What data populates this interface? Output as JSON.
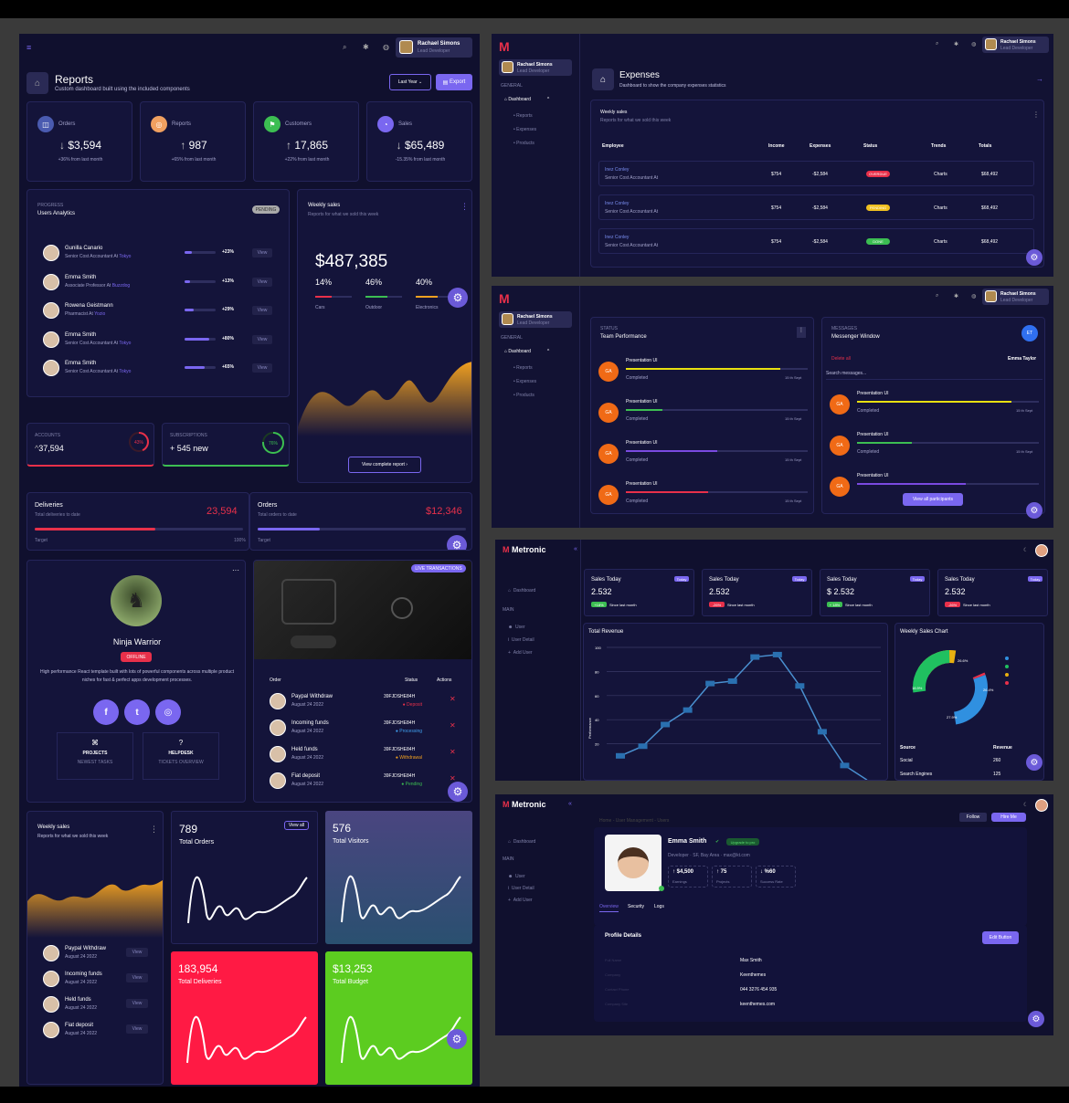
{
  "left": {
    "header": {
      "user_name": "Rachael Simons",
      "user_role": "Lead Developer"
    },
    "page": {
      "title": "Reports",
      "subtitle": "Custom dashboard built using the included components",
      "filter": "Last Year",
      "export": "Export"
    },
    "stats": [
      {
        "label": "Orders",
        "value": "$3,594",
        "dir": "↓",
        "note": "+36% from last month",
        "color": "#4a5bb0",
        "icon": "◫"
      },
      {
        "label": "Reports",
        "value": "987",
        "dir": "↑",
        "note": "+65% from last month",
        "color": "#f0a060",
        "icon": "◎"
      },
      {
        "label": "Customers",
        "value": "17,865",
        "dir": "↑",
        "note": "+22% from last month",
        "color": "#3cbe52",
        "icon": "⚑"
      },
      {
        "label": "Sales",
        "value": "$65,489",
        "dir": "↓",
        "note": "-15.35% from last month",
        "color": "#7a67f0",
        "icon": "◔"
      }
    ],
    "analytics": {
      "kicker": "PROGRESS",
      "title": "Users Analytics",
      "badge": "PENDING",
      "view": "View",
      "rows": [
        {
          "name": "Gunilla Canario",
          "role": "Senior Cost Accountant At",
          "org": "Tokyo",
          "pct": "+23%",
          "fill": 0.23
        },
        {
          "name": "Emma Smith",
          "role": "Associate Professor At",
          "org": "Buzzdog",
          "pct": "+13%",
          "fill": 0.13
        },
        {
          "name": "Rowena Geistmann",
          "role": "Pharmacist At",
          "org": "Yozio",
          "pct": "+29%",
          "fill": 0.29
        },
        {
          "name": "Emma Smith",
          "role": "Senior Cost Accountant At",
          "org": "Tokyo",
          "pct": "+80%",
          "fill": 0.8
        },
        {
          "name": "Emma Smith",
          "role": "Senior Cost Accountant At",
          "org": "Tokyo",
          "pct": "+65%",
          "fill": 0.65
        }
      ]
    },
    "weekly": {
      "title": "Weekly sales",
      "subtitle": "Reports for what we sold this week",
      "amount": "$487,385",
      "splits": [
        {
          "pct": "14%",
          "label": "Cars",
          "color": "#e8304a"
        },
        {
          "pct": "46%",
          "label": "Outdoor",
          "color": "#3cbe52"
        },
        {
          "pct": "40%",
          "label": "Electronics",
          "color": "#f0a020"
        }
      ],
      "button": "View complete report ›"
    },
    "accounts": {
      "label": "ACCOUNTS",
      "value": "37,594",
      "pct": "43%",
      "fill": 0.43
    },
    "subs": {
      "label": "SUBSCRIPTIONS",
      "value": "+ 545 new",
      "pct": "76%",
      "fill": 0.76
    },
    "deliveries": {
      "title": "Deliveries",
      "subtitle": "Total deliveries to date",
      "value": "23,594",
      "target": "Target",
      "target_pct": "100%",
      "fill": 0.58
    },
    "orders": {
      "title": "Orders",
      "subtitle": "Total orders to date",
      "value": "$12,346",
      "target": "Target",
      "fill": 0.3
    },
    "profile": {
      "name": "Ninja Warrior",
      "status": "OFFLINE",
      "bio": "High performance React template built with lots of powerful components across multiple product niches for fast & perfect apps development processes.",
      "tiles": [
        {
          "title": "PROJECTS",
          "sub": "NEWEST TASKS"
        },
        {
          "title": "HELPDESK",
          "sub": "TICKETS OVERVIEW"
        }
      ]
    },
    "transactions": {
      "badge": "LIVE TRANSACTIONS",
      "col_order": "Order",
      "col_status": "Status",
      "col_actions": "Actions",
      "rows": [
        {
          "title": "Paypal Withdraw",
          "date": "August 24 2022",
          "id": "39FJDSHE84H",
          "status": "Deposit",
          "color": "#e8304a"
        },
        {
          "title": "Incoming funds",
          "date": "August 24 2022",
          "id": "39FJDSHE84H",
          "status": "Processing",
          "color": "#40a0f0"
        },
        {
          "title": "Held funds",
          "date": "August 24 2022",
          "id": "39FJDSHE84H",
          "status": "Withdrawal",
          "color": "#f0a020"
        },
        {
          "title": "Fiat deposit",
          "date": "August 24 2022",
          "id": "39FJDSHE84H",
          "status": "Pending",
          "color": "#3cbe52"
        }
      ]
    },
    "weekly2": {
      "title": "Weekly sales",
      "subtitle": "Reports for what we sold this week",
      "view": "View",
      "rows": [
        {
          "title": "Paypal Withdraw",
          "date": "August 24 2022"
        },
        {
          "title": "Incoming funds",
          "date": "August 24 2022"
        },
        {
          "title": "Held funds",
          "date": "August 24 2022"
        },
        {
          "title": "Fiat deposit",
          "date": "August 24 2022"
        }
      ]
    },
    "tiles": [
      {
        "value": "789",
        "label": "Total Orders",
        "link": "View all"
      },
      {
        "value": "576",
        "label": "Total Visitors"
      },
      {
        "value": "183,954",
        "label": "Total Deliveries"
      },
      {
        "value": "$13,253",
        "label": "Total Budget"
      }
    ]
  },
  "sidebar": {
    "user": "Rachael Simons",
    "role": "Lead Developer",
    "section": "GENERAL",
    "dashboard": "Dashboard",
    "items": [
      "Reports",
      "Expenses",
      "Products"
    ]
  },
  "expenses": {
    "title": "Expenses",
    "subtitle": "Dashboard to show the company expenses statistics",
    "card_title": "Weekly sales",
    "card_sub": "Reports for what we sold this week",
    "cols": [
      "Employee",
      "Income",
      "Expenses",
      "Status",
      "Trends",
      "Totals"
    ],
    "rows": [
      {
        "name": "Inez Conley",
        "role": "Senior Cost Accountant At",
        "income": "$754",
        "exp": "-$2,584",
        "status": "OVERDUE",
        "color": "#e8304a",
        "trend": "Charts",
        "total": "$68,492"
      },
      {
        "name": "Inez Conley",
        "role": "Senior Cost Accountant At",
        "income": "$754",
        "exp": "-$2,584",
        "status": "PENDING",
        "color": "#f0c020",
        "trend": "Charts",
        "total": "$68,492"
      },
      {
        "name": "Inez Conley",
        "role": "Senior Cost Accountant At",
        "income": "$754",
        "exp": "-$2,584",
        "status": "DONE",
        "color": "#3cbe52",
        "trend": "Charts",
        "total": "$68,492"
      }
    ]
  },
  "team": {
    "kicker": "STATUS",
    "title": "Team Performance",
    "avatar": "GA",
    "rows": [
      {
        "title": "Presentation UI",
        "status": "Completed",
        "date": "15 th Sept",
        "color": "#e8e010",
        "fill": 0.85
      },
      {
        "title": "Presentation UI",
        "status": "Completed",
        "date": "15 th Sept",
        "color": "#3cbe52",
        "fill": 0.2
      },
      {
        "title": "Presentation UI",
        "status": "Completed",
        "date": "15 th Sept",
        "color": "#7a4ae0",
        "fill": 0.5
      },
      {
        "title": "Presentation UI",
        "status": "Completed",
        "date": "15 th Sept",
        "color": "#e8304a",
        "fill": 0.45
      }
    ]
  },
  "messages": {
    "kicker": "MESSAGES",
    "title": "Messenger Window",
    "badge": "ET",
    "delete": "Delete all",
    "person": "Emma Taylor",
    "search": "Search messages...",
    "button": "View all participants",
    "rows": [
      {
        "title": "Presentation UI",
        "status": "Completed",
        "date": "15 th Sept",
        "color": "#e8e010",
        "fill": 0.85
      },
      {
        "title": "Presentation UI",
        "status": "Completed",
        "date": "15 th Sept",
        "color": "#3cbe52",
        "fill": 0.3
      },
      {
        "title": "Presentation UI",
        "status": "",
        "date": "",
        "color": "#7a4ae0",
        "fill": 0.6
      }
    ]
  },
  "metronic": {
    "brand": "Metronic",
    "nav": {
      "dashboard": "Dashboard",
      "section": "MAIN",
      "items": [
        "User",
        "User Detail",
        "Add User"
      ]
    },
    "sales": [
      {
        "title": "Sales Today",
        "value": "2.532",
        "tag": "Today",
        "pill": "+18%",
        "pill_color": "#3cbe52",
        "note": "Since last month"
      },
      {
        "title": "Sales Today",
        "value": "2.532",
        "tag": "Today",
        "pill": "-26%",
        "pill_color": "#e8304a",
        "note": "Since last month"
      },
      {
        "title": "Sales Today",
        "value": "$ 2.532",
        "tag": "Today",
        "pill": "+ 18%",
        "pill_color": "#3cbe52",
        "note": "Since last month"
      },
      {
        "title": "Sales Today",
        "value": "2.532",
        "tag": "Today",
        "pill": "-26%",
        "pill_color": "#e8304a",
        "note": "Since last month"
      }
    ],
    "revenue": {
      "title": "Total Revenue",
      "ylabel": "Performance",
      "yticks": [
        "100",
        "80",
        "60",
        "40",
        "20"
      ]
    },
    "donut": {
      "title": "Weekly Sales Chart",
      "labels": [
        "26.6%",
        "26.4%",
        "27.9%",
        "18.9%"
      ],
      "source": "Source",
      "revenue": "Revenue",
      "rows": [
        {
          "name": "Social",
          "value": "260"
        },
        {
          "name": "Search Engines",
          "value": "125"
        }
      ]
    }
  },
  "chart_data": {
    "type": "line",
    "title": "Total Revenue",
    "xlabel": "",
    "ylabel": "Performance",
    "ylim": [
      0,
      100
    ],
    "x": [
      1,
      2,
      3,
      4,
      5,
      6,
      7,
      8,
      9,
      10,
      11,
      12
    ],
    "series": [
      {
        "values": [
          10,
          18,
          36,
          48,
          70,
          72,
          92,
          94,
          68,
          30,
          2,
          -10
        ]
      }
    ]
  },
  "profile_page": {
    "brand": "Metronic",
    "breadcrumb": "Home - User Management - Users",
    "name": "Emma Smith",
    "upgrade": "Upgrade to pro",
    "meta": "Developer · SF, Bay Area · max@kt.com",
    "stats": [
      {
        "value": "↑ $4,500",
        "label": "Earnings"
      },
      {
        "value": "↑ 75",
        "label": "Projects"
      },
      {
        "value": "↓ %60",
        "label": "Success Rate"
      }
    ],
    "tabs": [
      "Overview",
      "Security",
      "Logs"
    ],
    "details_title": "Profile Details",
    "edit": "Edit Button",
    "top_btn": "Follow",
    "top_btn2": "Hire Me",
    "fields": [
      {
        "label": "Full Name",
        "value": "Max Smith"
      },
      {
        "label": "Company",
        "value": "Keenthemes"
      },
      {
        "label": "Contact Phone",
        "value": "044 3276 454 935"
      },
      {
        "label": "Company Site",
        "value": "keenthemes.com"
      }
    ]
  }
}
